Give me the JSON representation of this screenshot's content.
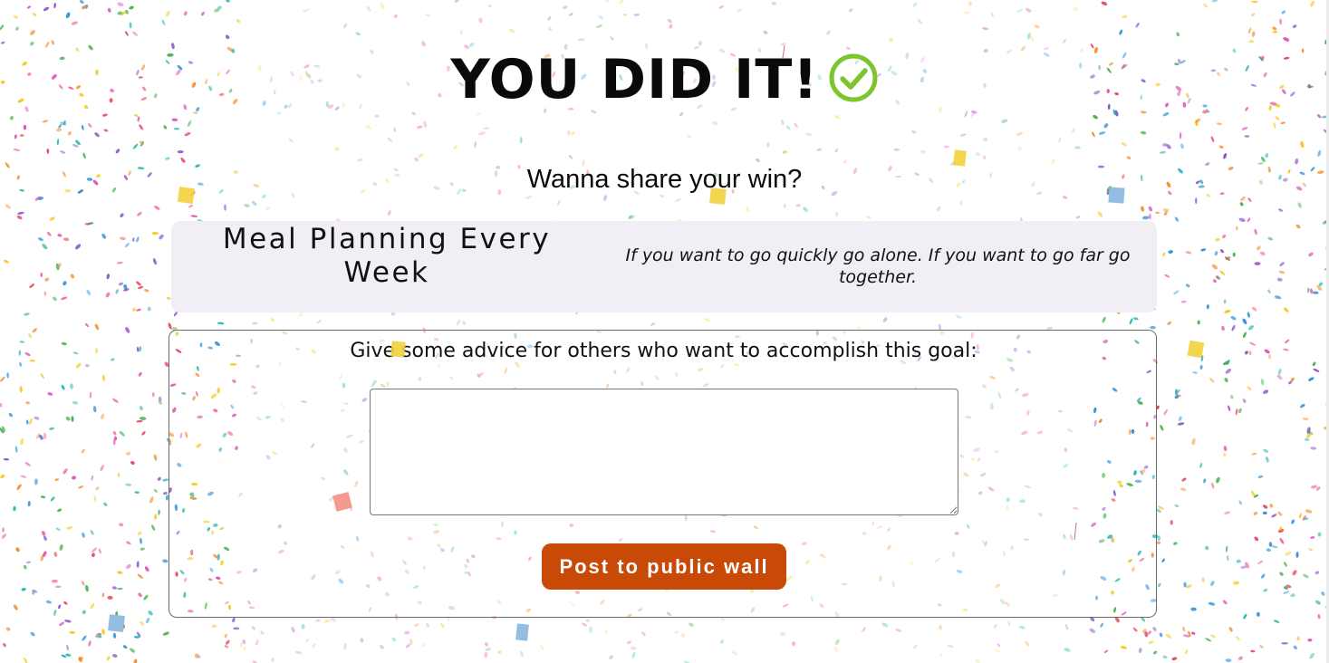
{
  "page": {
    "title": "YOU DID IT!",
    "title_icon": "check-circle-icon",
    "subtitle": "Wanna share your win?"
  },
  "goal": {
    "name": "Meal Planning Every Week",
    "quote": "If you want to go quickly go alone. If you want to go far go together."
  },
  "advice_form": {
    "label": "Give some advice for others who want to accomplish this goal:",
    "input_value": "",
    "input_placeholder": "",
    "submit_label": "Post to public wall"
  },
  "colors": {
    "accent_button": "#c94a06",
    "check_icon": "#7dc52c",
    "goal_card_bg": "#f1eff5",
    "confetti": [
      "#e8425a",
      "#f2c511",
      "#2c8fd6",
      "#3fae4a",
      "#f08a24",
      "#8b4fc9",
      "#e04bb5",
      "#24b3b0"
    ]
  }
}
